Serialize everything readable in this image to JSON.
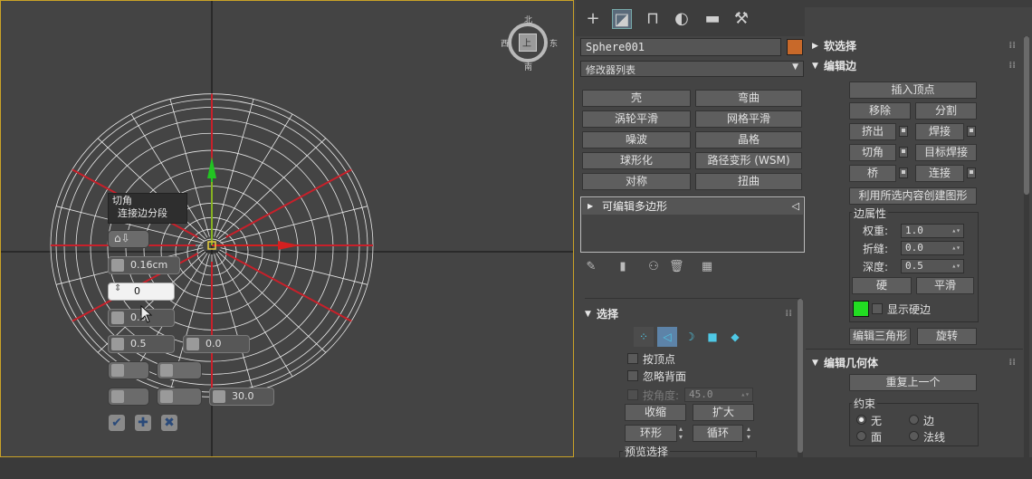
{
  "viewport": {
    "viewcube_label": "上",
    "viewcube_top": "北",
    "viewcube_bottom": "南",
    "viewcube_left": "西",
    "viewcube_right": "东"
  },
  "caddy": {
    "title": "切角",
    "subtitle": "连接边分段",
    "amount": "0.16cm",
    "segments": "0",
    "tension": "0.0",
    "depth_a": "0.5",
    "depth_b": "0.0",
    "angle": "30.0"
  },
  "tabs": [
    "create-icon",
    "modify-icon",
    "hierarchy-icon",
    "motion-icon",
    "display-icon",
    "utilities-icon"
  ],
  "object_name": "Sphere001",
  "object_color": "#c8692a",
  "modifier_list": "修改器列表",
  "modifier_buttons": [
    [
      "壳",
      "弯曲"
    ],
    [
      "涡轮平滑",
      "网格平滑"
    ],
    [
      "噪波",
      "晶格"
    ],
    [
      "球形化",
      "路径变形 (WSM)"
    ],
    [
      "对称",
      "扭曲"
    ]
  ],
  "stack_item": "可编辑多边形",
  "selection": {
    "title": "选择",
    "by_vertex": "按顶点",
    "ignore_backfacing": "忽略背面",
    "by_angle": "按角度:",
    "angle_value": "45.0",
    "shrink": "收缩",
    "grow": "扩大",
    "ring": "环形",
    "loop": "循环",
    "preview": "预览选择"
  },
  "soft_selection": {
    "title": "软选择"
  },
  "edit_edges": {
    "title": "编辑边",
    "insert_vertex": "插入顶点",
    "remove": "移除",
    "split": "分割",
    "extrude": "挤出",
    "weld": "焊接",
    "chamfer": "切角",
    "target_weld": "目标焊接",
    "bridge": "桥",
    "connect": "连接",
    "create_shape": "利用所选内容创建图形",
    "edge_props": "边属性",
    "weight_label": "权重:",
    "weight": "1.0",
    "crease_label": "折缝:",
    "crease": "0.0",
    "depth_label": "深度:",
    "depth": "0.5",
    "hard": "硬",
    "smooth": "平滑",
    "show_hard": "显示硬边",
    "hard_color": "#22dd22",
    "edit_tri": "编辑三角形",
    "turn": "旋转"
  },
  "edit_geometry": {
    "title": "编辑几何体",
    "repeat_last": "重复上一个",
    "constraints": "约束",
    "none": "无",
    "edge": "边",
    "face": "面",
    "normal": "法线"
  }
}
